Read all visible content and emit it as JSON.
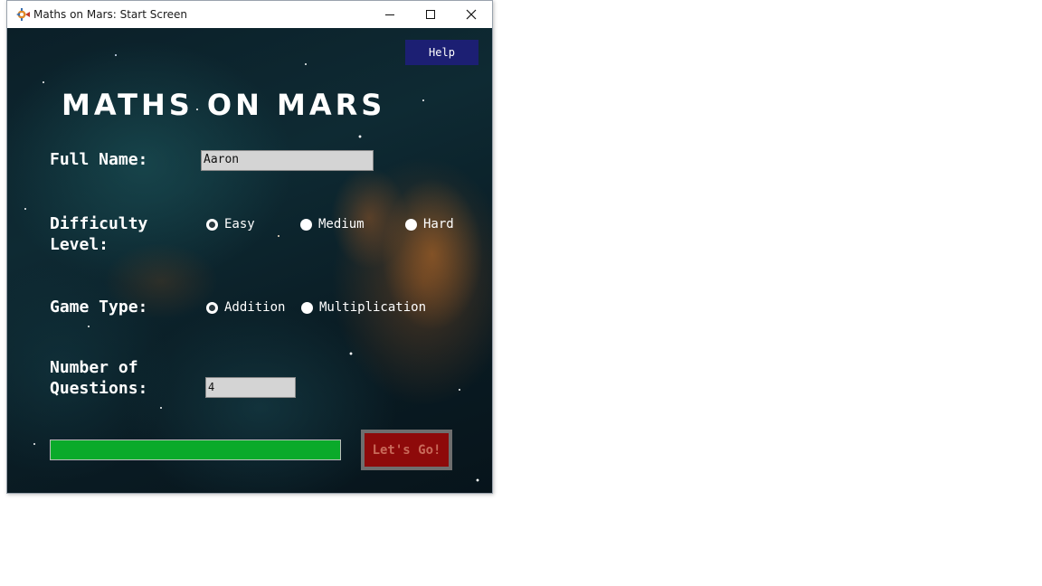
{
  "window": {
    "title": "Maths on Mars: Start Screen",
    "icon": "rocket-app-icon",
    "controls": [
      "minimize-icon",
      "maximize-icon",
      "close-icon"
    ]
  },
  "help": {
    "label": "Help",
    "color": "#1c1f73"
  },
  "app_title": "MATHS ON MARS",
  "form": {
    "name_label": "Full Name:",
    "name_value": "Aaron",
    "difficulty_label": "Difficulty\nLevel:",
    "difficulty_options": [
      "Easy",
      "Medium",
      "Hard"
    ],
    "difficulty_selected": "Easy",
    "game_type_label": "Game Type:",
    "game_type_options": [
      "Addition",
      "Multiplication"
    ],
    "game_type_selected": "Addition",
    "questions_label": "Number of\nQuestions:",
    "questions_value": "4"
  },
  "progress": {
    "fraction": 1.0,
    "color": "#0aaa2a"
  },
  "go_button": {
    "label": "Let's Go!",
    "color": "#8e0a0a"
  }
}
